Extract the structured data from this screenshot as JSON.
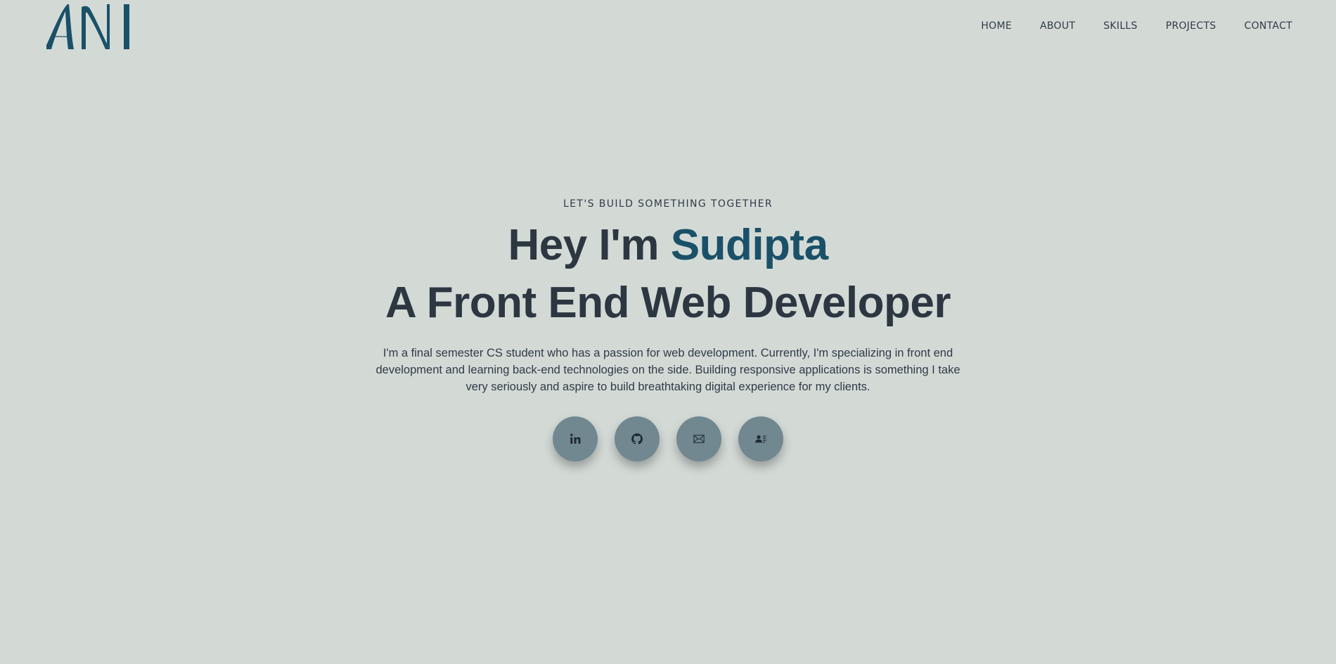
{
  "brand": {
    "logo_text": "ANI",
    "color": "#1a5168"
  },
  "nav": {
    "items": [
      {
        "label": "HOME"
      },
      {
        "label": "ABOUT"
      },
      {
        "label": "SKILLS"
      },
      {
        "label": "PROJECTS"
      },
      {
        "label": "CONTACT"
      }
    ]
  },
  "hero": {
    "eyebrow": "LET'S BUILD SOMETHING TOGETHER",
    "greeting": "Hey I'm",
    "name": "Sudipta",
    "role": "A Front End Web Developer",
    "bio": "I'm a final semester CS student who has a passion for web development. Currently, I'm specializing in front end development and learning back-end technologies on the side. Building responsive applications is something I take very seriously and aspire to build breathtaking digital experience for my clients."
  },
  "socials": [
    {
      "icon": "linkedin-icon"
    },
    {
      "icon": "github-icon"
    },
    {
      "icon": "mail-icon"
    },
    {
      "icon": "contact-card-icon"
    }
  ],
  "colors": {
    "background": "#d3dad6",
    "text": "#2d3741",
    "accent": "#1a5168",
    "button": "#718891"
  }
}
